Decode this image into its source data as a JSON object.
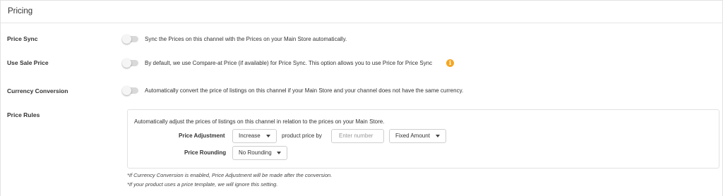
{
  "section": {
    "title": "Pricing"
  },
  "price_sync": {
    "label": "Price Sync",
    "enabled": false,
    "description": "Sync the Prices on this channel with the Prices on your Main Store automatically."
  },
  "use_sale_price": {
    "label": "Use Sale Price",
    "enabled": false,
    "description": "By default, we use Compare-at Price (if available) for Price Sync. This option allows you to use Price for Price Sync",
    "info_glyph": "i",
    "info_color": "#f5a623"
  },
  "currency_conversion": {
    "label": "Currency Conversion",
    "enabled": false,
    "description": "Automatically convert the price of listings on this channel if your Main Store and your channel does not have the same currency."
  },
  "price_rules": {
    "label": "Price Rules",
    "description": "Automatically adjust the prices of listings on this channel in relation to the prices on your Main Store.",
    "adjustment": {
      "label": "Price Adjustment",
      "direction_value": "Increase",
      "connector_text": "product price by",
      "amount_placeholder": "Enter number",
      "type_value": "Fixed Amount"
    },
    "rounding": {
      "label": "Price Rounding",
      "value": "No Rounding"
    }
  },
  "notes": {
    "note1": "*If Currency Conversion is enabled, Price Adjustment will be made after the conversion.",
    "note2": "*If your product uses a price template, we will ignore this setting."
  }
}
